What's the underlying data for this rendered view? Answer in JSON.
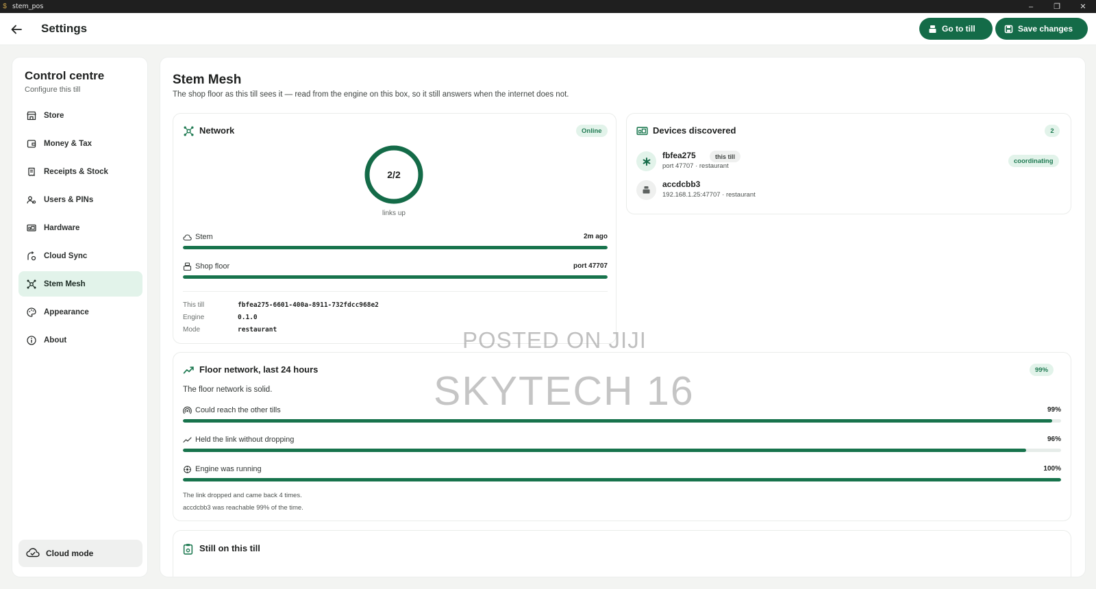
{
  "window": {
    "title": "stem_pos",
    "controls": [
      "–",
      "❐",
      "✕"
    ]
  },
  "header": {
    "title": "Settings",
    "go_to_till_label": "Go to till",
    "save_label": "Save changes"
  },
  "sidebar": {
    "title": "Control centre",
    "subtitle": "Configure this till",
    "items": [
      {
        "label": "Store",
        "icon": "store-icon"
      },
      {
        "label": "Money & Tax",
        "icon": "wallet-icon"
      },
      {
        "label": "Receipts & Stock",
        "icon": "receipt-icon"
      },
      {
        "label": "Users & PINs",
        "icon": "users-icon"
      },
      {
        "label": "Hardware",
        "icon": "hardware-icon"
      },
      {
        "label": "Cloud Sync",
        "icon": "cloud-sync-icon"
      },
      {
        "label": "Stem Mesh",
        "icon": "mesh-icon",
        "active": true
      },
      {
        "label": "Appearance",
        "icon": "palette-icon"
      },
      {
        "label": "About",
        "icon": "info-icon"
      }
    ],
    "cloud_mode_label": "Cloud mode"
  },
  "main": {
    "title": "Stem Mesh",
    "description": "The shop floor as this till sees it — read from the engine on this box, so it still answers when the internet does not."
  },
  "network": {
    "title": "Network",
    "status": "Online",
    "links_up": "2/2",
    "links_up_fraction": 1.0,
    "links_caption": "links up",
    "links": [
      {
        "label": "Stem",
        "value": "2m ago",
        "fill": 1.0,
        "icon": "cloud-icon"
      },
      {
        "label": "Shop floor",
        "value": "port 47707",
        "fill": 1.0,
        "icon": "till-icon"
      }
    ],
    "info": {
      "this_till_key": "This till",
      "this_till": "fbfea275-6601-400a-8911-732fdcc968e2",
      "engine_key": "Engine",
      "engine": "0.1.0",
      "mode_key": "Mode",
      "mode": "restaurant"
    }
  },
  "devices": {
    "title": "Devices discovered",
    "count": "2",
    "items": [
      {
        "name": "fbfea275",
        "tag": "this till",
        "meta": "port 47707 · restaurant",
        "status": "coordinating"
      },
      {
        "name": "accdcbb3",
        "meta": "192.168.1.25:47707 · restaurant"
      }
    ]
  },
  "floor": {
    "title": "Floor network, last 24 hours",
    "badge": "99%",
    "summary": "The floor network is solid.",
    "metrics": [
      {
        "label": "Could reach the other tills",
        "value": "99%",
        "fill": 0.99,
        "icon": "signal-icon"
      },
      {
        "label": "Held the link without dropping",
        "value": "96%",
        "fill": 0.96,
        "icon": "trend-icon"
      },
      {
        "label": "Engine was running",
        "value": "100%",
        "fill": 1.0,
        "icon": "engine-icon"
      }
    ],
    "notes": [
      "The link dropped and came back 4 times.",
      "accdcbb3 was reachable 99% of the time."
    ]
  },
  "still": {
    "title": "Still on this till"
  },
  "watermark": {
    "line1": "POSTED ON JIJI",
    "line2": "SKYTECH 16"
  },
  "colors": {
    "accent": "#146b48",
    "bar": "#17734c",
    "active_bg": "#e2f3ea"
  }
}
